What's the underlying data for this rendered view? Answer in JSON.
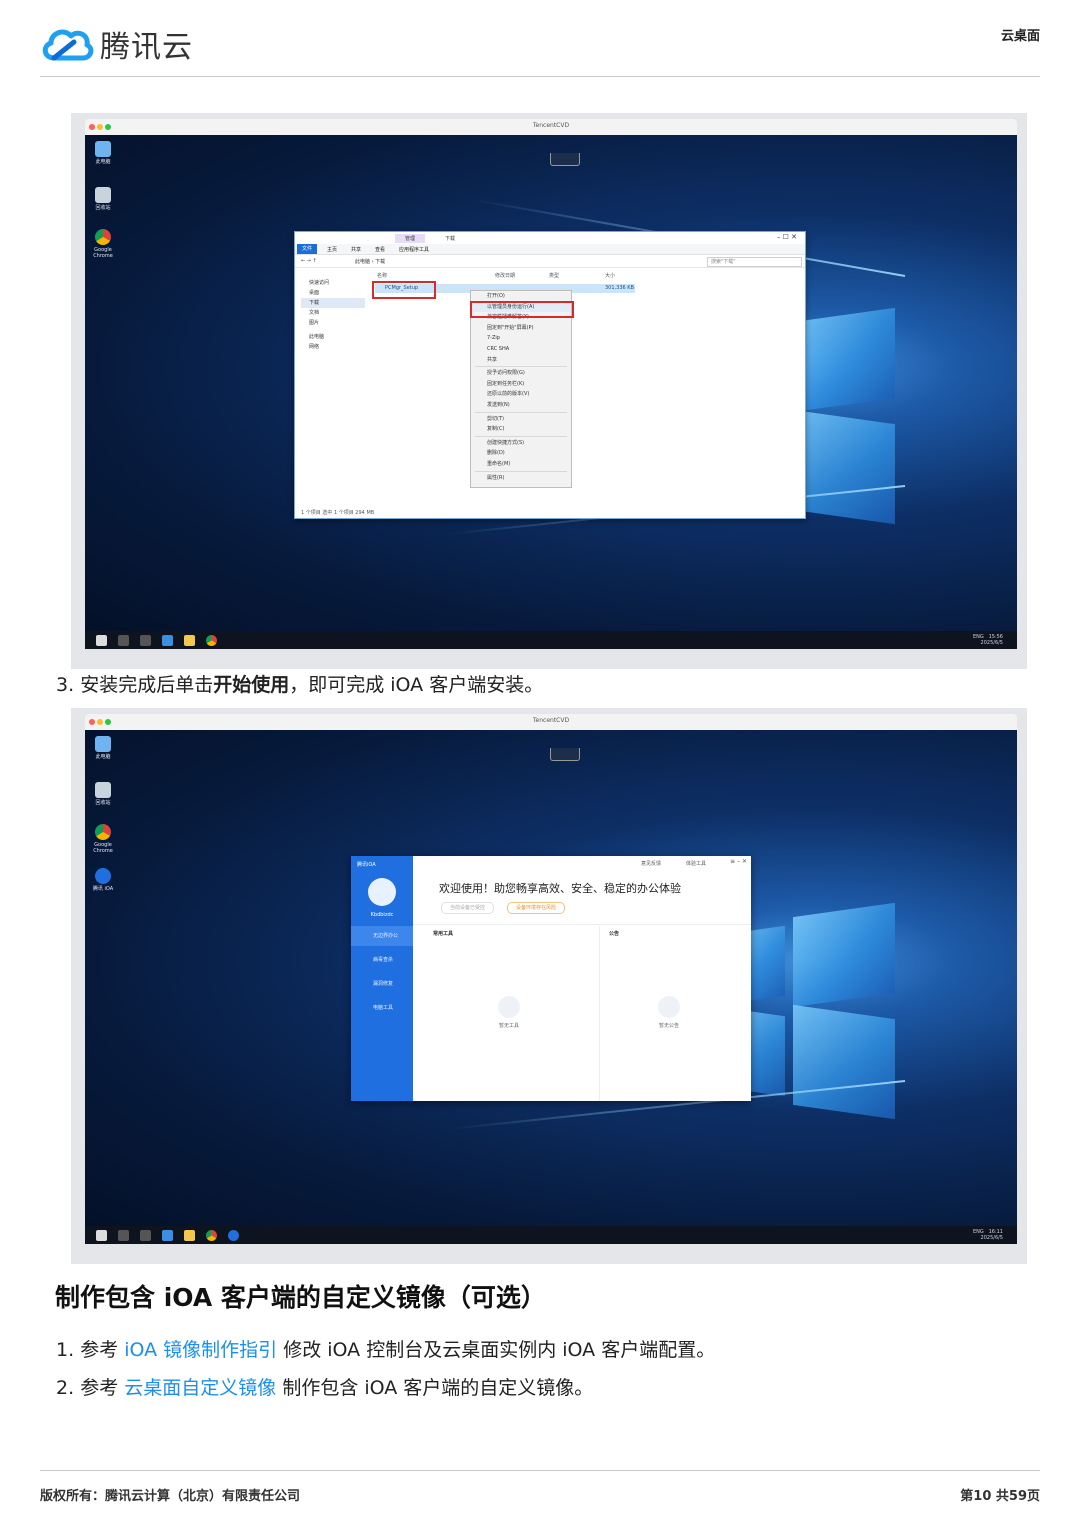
{
  "header": {
    "brand": "腾讯云",
    "doc_tag": "云桌面"
  },
  "screenshot1": {
    "vm_title": "TencentCVD",
    "desktop_icons": [
      "此电脑",
      "回收站",
      "Google Chrome"
    ],
    "explorer": {
      "tabs": [
        "文件",
        "主页",
        "共享",
        "查看",
        "应用程序工具"
      ],
      "manage_tab": "管理",
      "download_tab": "下载",
      "breadcrumb": "此电脑 › 下载",
      "search_placeholder": "搜索\"下载\"",
      "sidebar": [
        "快速访问",
        "桌面",
        "下载",
        "文档",
        "图片",
        "此电脑",
        "网络"
      ],
      "columns": [
        "名称",
        "修改日期",
        "类型",
        "大小"
      ],
      "file_name": "PCMgr_Setup",
      "file_size": "301,336 KB",
      "status": "1 个项目    选中 1 个项目  294 MB"
    },
    "context_menu": [
      "打开(O)",
      "以管理员身份运行(A)",
      "兼容性疑难解答(Y)",
      "固定到\"开始\"屏幕(P)",
      "7-Zip",
      "CRC SHA",
      "共享",
      "授予访问权限(G)",
      "固定到任务栏(K)",
      "还原以前的版本(V)",
      "发送到(N)",
      "剪切(T)",
      "复制(C)",
      "创建快捷方式(S)",
      "删除(D)",
      "重命名(M)",
      "属性(R)"
    ],
    "tray": {
      "lang": "ENG",
      "time": "15:56",
      "date": "2025/6/5"
    }
  },
  "step3": {
    "number": "3.",
    "prefix": "安装完成后单击",
    "bold": "开始使用",
    "suffix": "，即可完成 iOA 客户端安装。"
  },
  "screenshot2": {
    "vm_title": "TencentCVD",
    "desktop_icons": [
      "此电脑",
      "回收站",
      "Google Chrome",
      "腾讯 iOA"
    ],
    "ioa": {
      "brand": "腾讯iOA",
      "user": "Kbdbizdc",
      "nav": [
        "无边界办公",
        "病毒查杀",
        "漏洞修复",
        "电脑工具"
      ],
      "top_buttons": [
        "意见反馈",
        "体验工具"
      ],
      "welcome": "欢迎使用！助您畅享高效、安全、稳定的办公体验",
      "chip_left": "当前设备已受控",
      "chip_right": "设备环境存在风险",
      "panel_left_title": "常用工具",
      "panel_right_title": "公告",
      "empty_left": "暂无工具",
      "empty_right": "暂无公告"
    },
    "tray": {
      "lang": "ENG",
      "time": "16:11",
      "date": "2025/6/5"
    }
  },
  "section": {
    "title": "制作包含 iOA 客户端的自定义镜像（可选）"
  },
  "steps": [
    {
      "number": "1.",
      "prefix": "参考",
      "link": "iOA 镜像制作指引",
      "suffix": "修改 iOA 控制台及云桌面实例内 iOA 客户端配置。"
    },
    {
      "number": "2.",
      "prefix": "参考",
      "link": "云桌面自定义镜像",
      "suffix": "制作包含 iOA 客户端的自定义镜像。"
    }
  ],
  "footer": {
    "copyright": "版权所有：腾讯云计算（北京）有限责任公司",
    "page": "第10 共59页"
  },
  "colors": {
    "link": "#1b8ff0",
    "ioa_blue": "#1f6fe0",
    "highlight_red": "#d62b2b"
  }
}
